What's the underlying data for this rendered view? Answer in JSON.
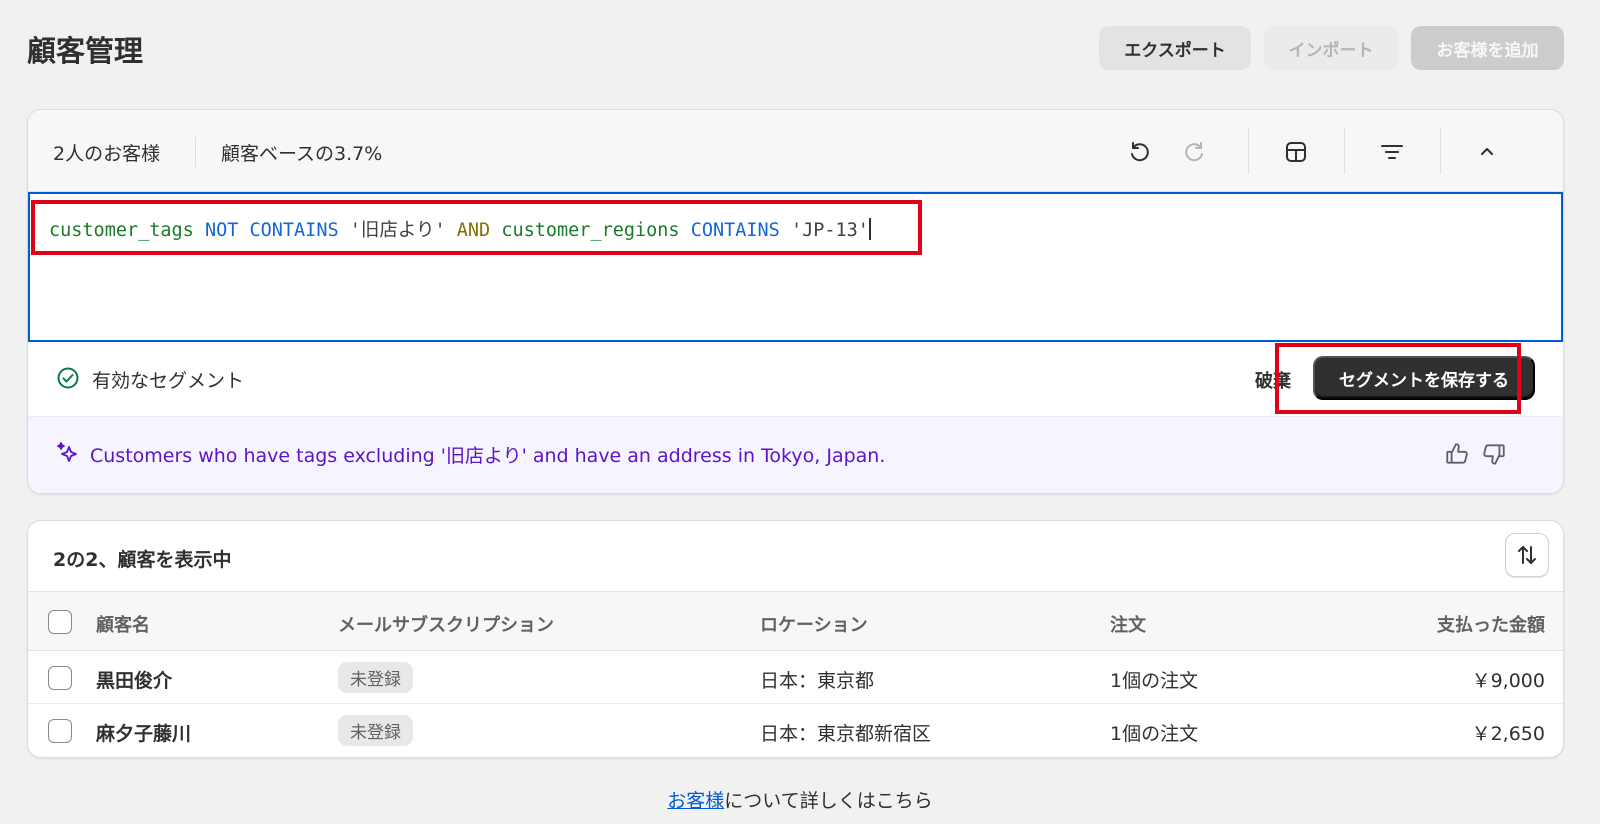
{
  "page": {
    "title": "顧客管理",
    "export_label": "エクスポート",
    "import_label": "インポート",
    "add_label": "お客様を追加"
  },
  "segment": {
    "count_label": "2人のお客様",
    "percent_label": "顧客ベースの3.7%",
    "toolbar_icons": [
      "undo-icon",
      "redo-icon",
      "columns-icon",
      "filter-icon",
      "chevron-up-icon"
    ],
    "query": {
      "t1": "customer_tags",
      "t2": "NOT CONTAINS",
      "t3": "'旧店より'",
      "t4": "AND",
      "t5": "customer_regions",
      "t6": "CONTAINS",
      "t7": "'JP-13'"
    },
    "status_label": "有効なセグメント",
    "discard_label": "破棄",
    "save_label": "セグメントを保存する",
    "ai_summary": "Customers who have tags excluding '旧店より' and have an address in Tokyo, Japan."
  },
  "customers": {
    "title": "2の2、顧客を表示中",
    "columns": [
      "顧客名",
      "メールサブスクリプション",
      "ロケーション",
      "注文",
      "支払った金額"
    ],
    "rows": [
      {
        "name": "黒田俊介",
        "subscription": "未登録",
        "location": "日本：東京都",
        "orders": "1個の注文",
        "amount": "￥9,000"
      },
      {
        "name": "麻夕子藤川",
        "subscription": "未登録",
        "location": "日本：東京都新宿区",
        "orders": "1個の注文",
        "amount": "￥2,650"
      }
    ]
  },
  "footer": {
    "link_text": "お客様",
    "rest_text": "について詳しくはこちら"
  },
  "colors": {
    "accent": "#005bd3",
    "highlight": "#e1001a",
    "ai_text": "#5c14c9",
    "primary_button": "#303030"
  }
}
